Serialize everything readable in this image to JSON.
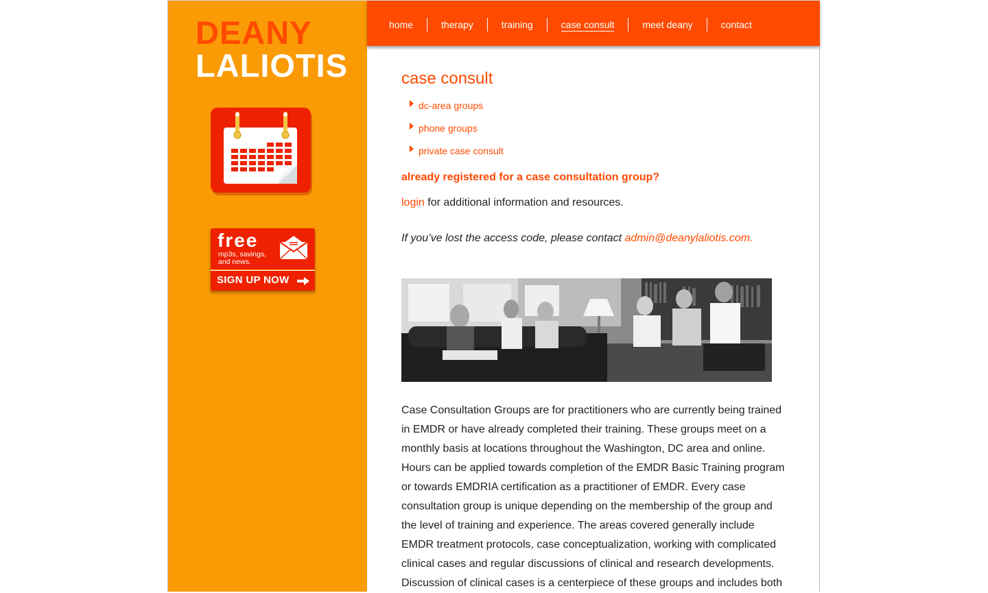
{
  "logo": {
    "line1": "DEANY",
    "line2": "LALIOTIS"
  },
  "nav": {
    "items": [
      {
        "label": "home"
      },
      {
        "label": "therapy"
      },
      {
        "label": "training"
      },
      {
        "label": "case consult",
        "active": true
      },
      {
        "label": "meet deany"
      },
      {
        "label": "contact"
      }
    ]
  },
  "sidebar": {
    "calendar_icon": "calendar-icon",
    "signup": {
      "free": "free",
      "sub": "mp3s, savings, and news.",
      "cta": "SIGN UP NOW",
      "icon": "envelope-icon"
    }
  },
  "main": {
    "title": "case consult",
    "sub_links": [
      {
        "label": "dc-area groups"
      },
      {
        "label": "phone groups"
      },
      {
        "label": "private case consult"
      }
    ],
    "registered_question": "already registered for a case consultation group?",
    "login_link": "login",
    "login_rest": " for additional information and resources.",
    "lost_text": "If you’ve lost the access code, please contact ",
    "lost_email": "admin@deanylaliotis.com.",
    "body_paragraph": "Case Consultation Groups are for practitioners who are currently being trained in EMDR or have already completed their training. These groups meet on a monthly basis at locations throughout the Washington, DC area and online. Hours can be applied towards completion of the EMDR Basic Training program or towards EMDRIA certification as a practitioner of EMDR. Every case consultation group is unique depending on the membership of the group and the level of training and experience. The areas covered generally include EMDR treatment protocols, case conceptualization, working with complicated clinical cases and regular discussions of clinical and research developments. Discussion of clinical cases is a centerpiece of these groups and includes both"
  },
  "colors": {
    "accent": "#ff4a00",
    "sidebar": "#fa9a05",
    "button_red": "#ee2200"
  }
}
